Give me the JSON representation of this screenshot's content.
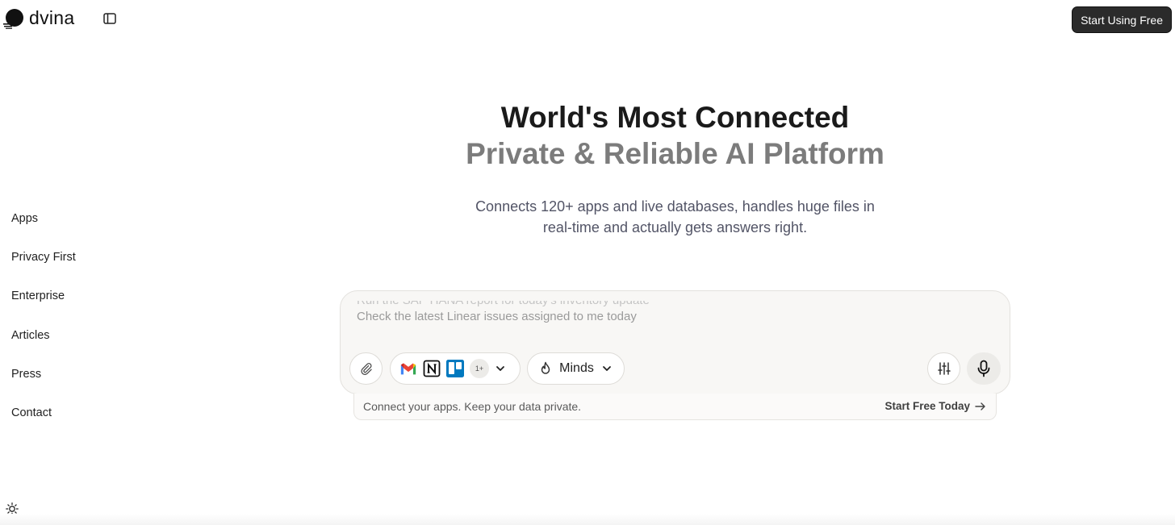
{
  "header": {
    "logo_text": "dvina",
    "cta_label": "Start Using Free"
  },
  "nav": {
    "items": [
      {
        "label": "Apps"
      },
      {
        "label": "Privacy First"
      },
      {
        "label": "Enterprise"
      },
      {
        "label": "Articles"
      },
      {
        "label": "Press"
      },
      {
        "label": "Contact"
      }
    ]
  },
  "hero": {
    "title_line1": "World's Most Connected",
    "title_line2": "Private & Reliable AI Platform",
    "subtitle_line1": "Connects 120+ apps and live databases, handles huge files in",
    "subtitle_line2": "real-time and actually gets answers right."
  },
  "prompt": {
    "suggestion_previous": "Run the SAP HANA report for today's inventory update",
    "suggestion_current": "Check the latest Linear issues assigned to me today",
    "apps_more_badge": "1+",
    "minds_label": "Minds"
  },
  "strip": {
    "left_text": "Connect your apps. Keep your data private.",
    "right_text": "Start Free Today"
  },
  "icons": {
    "logo": "dvina-logo-icon",
    "sidebar": "sidebar-toggle-icon",
    "attach": "paperclip-icon",
    "gmail": "gmail-icon",
    "notion": "notion-icon",
    "trello": "trello-icon",
    "chevron": "chevron-down-icon",
    "flame": "flame-icon",
    "settings": "sliders-icon",
    "mic": "microphone-icon",
    "arrow": "arrow-right-icon",
    "theme": "sun-icon"
  }
}
